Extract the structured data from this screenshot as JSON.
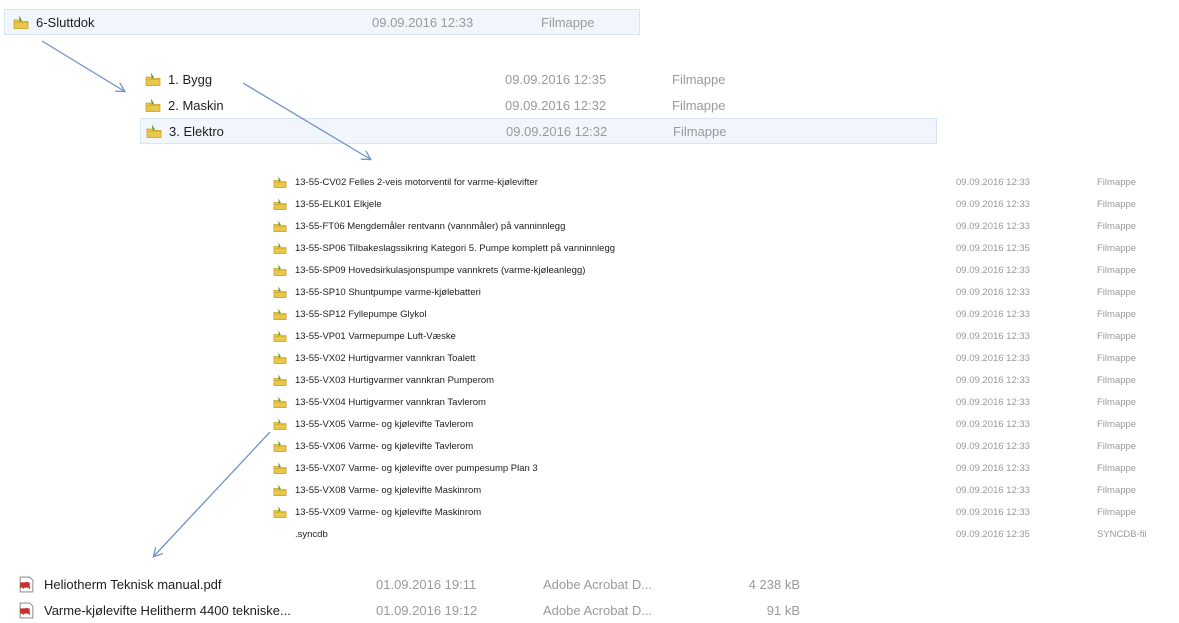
{
  "colors": {
    "folder": "#e8c84a",
    "folder_dark": "#c89b1c",
    "folder_green": "#5a9a2c",
    "arrow": "#6f93c4",
    "pdf_red": "#c8322c"
  },
  "level1": {
    "icon": "folder-icon",
    "name": "6-Sluttdok",
    "date": "09.09.2016 12:33",
    "type": "Filmappe"
  },
  "level2": [
    {
      "icon": "folder-icon",
      "name": "1. Bygg",
      "date": "09.09.2016 12:35",
      "type": "Filmappe"
    },
    {
      "icon": "folder-icon",
      "name": "2. Maskin",
      "date": "09.09.2016 12:32",
      "type": "Filmappe"
    },
    {
      "icon": "folder-icon",
      "name": "3. Elektro",
      "date": "09.09.2016 12:32",
      "type": "Filmappe"
    }
  ],
  "level3": [
    {
      "icon": "folder-icon",
      "name": "13-55-CV02 Felles 2-veis motorventil for varme-kjølevifter",
      "date": "09.09.2016 12:33",
      "type": "Filmappe"
    },
    {
      "icon": "folder-icon",
      "name": "13-55-ELK01 Elkjele",
      "date": "09.09.2016 12:33",
      "type": "Filmappe"
    },
    {
      "icon": "folder-icon",
      "name": "13-55-FT06 Mengdemåler rentvann (vannmåler) på vanninnlegg",
      "date": "09.09.2016 12:33",
      "type": "Filmappe"
    },
    {
      "icon": "folder-icon",
      "name": "13-55-SP06 Tilbakeslagssikring Kategori 5. Pumpe komplett på vanninnlegg",
      "date": "09.09.2016 12:35",
      "type": "Filmappe"
    },
    {
      "icon": "folder-icon",
      "name": "13-55-SP09 Hovedsirkulasjonspumpe vannkrets (varme-kjøleanlegg)",
      "date": "09.09.2016 12:33",
      "type": "Filmappe"
    },
    {
      "icon": "folder-icon",
      "name": "13-55-SP10 Shuntpumpe varme-kjølebatteri",
      "date": "09.09.2016 12:33",
      "type": "Filmappe"
    },
    {
      "icon": "folder-icon",
      "name": "13-55-SP12 Fyllepumpe Glykol",
      "date": "09.09.2016 12:33",
      "type": "Filmappe"
    },
    {
      "icon": "folder-icon",
      "name": "13-55-VP01 Varmepumpe Luft-Væske",
      "date": "09.09.2016 12:33",
      "type": "Filmappe"
    },
    {
      "icon": "folder-icon",
      "name": "13-55-VX02 Hurtigvarmer vannkran Toalett",
      "date": "09.09.2016 12:33",
      "type": "Filmappe"
    },
    {
      "icon": "folder-icon",
      "name": "13-55-VX03 Hurtigvarmer vannkran Pumperom",
      "date": "09.09.2016 12:33",
      "type": "Filmappe"
    },
    {
      "icon": "folder-icon",
      "name": "13-55-VX04 Hurtigvarmer vannkran Tavlerom",
      "date": "09.09.2016 12:33",
      "type": "Filmappe"
    },
    {
      "icon": "folder-icon",
      "name": "13-55-VX05 Varme- og kjølevifte Tavlerom",
      "date": "09.09.2016 12:33",
      "type": "Filmappe"
    },
    {
      "icon": "folder-icon",
      "name": "13-55-VX06 Varme- og kjølevifte Tavlerom",
      "date": "09.09.2016 12:33",
      "type": "Filmappe"
    },
    {
      "icon": "folder-icon",
      "name": "13-55-VX07 Varme- og kjølevifte over pumpesump Plan 3",
      "date": "09.09.2016 12:33",
      "type": "Filmappe"
    },
    {
      "icon": "folder-icon",
      "name": "13-55-VX08 Varme- og kjølevifte Maskinrom",
      "date": "09.09.2016 12:33",
      "type": "Filmappe"
    },
    {
      "icon": "folder-icon",
      "name": "13-55-VX09 Varme- og kjølevifte Maskinrom",
      "date": "09.09.2016 12:33",
      "type": "Filmappe"
    },
    {
      "icon": "",
      "name": ".syncdb",
      "date": "09.09.2016 12:35",
      "type": "SYNCDB-fil"
    }
  ],
  "level4": [
    {
      "icon": "pdf-icon",
      "name": "Heliotherm Teknisk manual.pdf",
      "date": "01.09.2016 19:11",
      "type": "Adobe Acrobat D...",
      "size": "4 238 kB"
    },
    {
      "icon": "pdf-icon",
      "name": "Varme-kjølevifte Helitherm 4400 tekniske...",
      "date": "01.09.2016 19:12",
      "type": "Adobe Acrobat D...",
      "size": "91 kB"
    }
  ]
}
